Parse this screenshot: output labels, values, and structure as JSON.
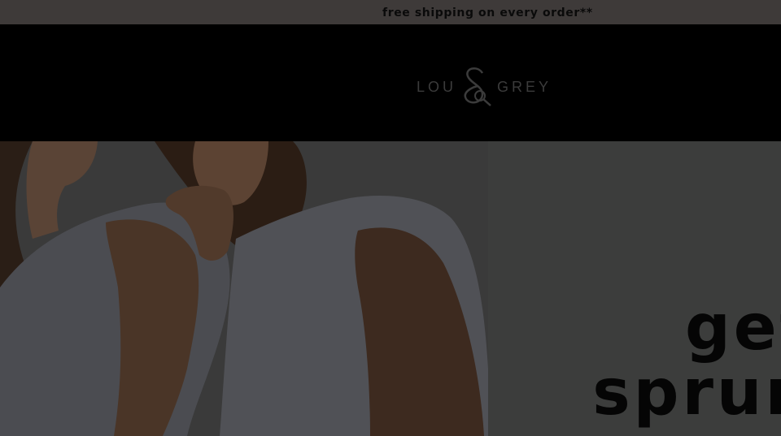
{
  "promo": {
    "text": "free shipping on every order**"
  },
  "header": {
    "logo": {
      "left_word": "LOU",
      "right_word": "GREY"
    }
  },
  "hero": {
    "photo_icon": "two-models-photo",
    "headline_line1": "get",
    "headline_line2": "sprun"
  },
  "colors": {
    "promo_bg": "#3e3a39",
    "header_bg": "#000000",
    "panel_bg": "#3c3d3c",
    "headline": "#050505"
  }
}
